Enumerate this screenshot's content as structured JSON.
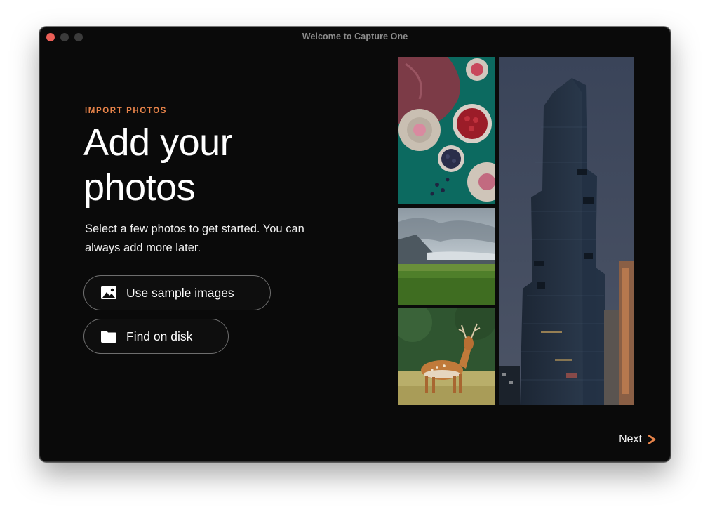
{
  "window": {
    "title": "Welcome to Capture One"
  },
  "main": {
    "eyebrow": "IMPORT PHOTOS",
    "headline": "Add your photos",
    "subtitle": "Select a few photos to get started. You can always add more later.",
    "buttons": [
      {
        "label": "Use sample images",
        "icon": "image-icon"
      },
      {
        "label": "Find on disk",
        "icon": "folder-icon"
      }
    ]
  },
  "gallery": {
    "images": [
      "food-flatlay",
      "landscape-glacier",
      "deer",
      "skyscraper"
    ]
  },
  "footer": {
    "next_label": "Next"
  },
  "colors": {
    "accent": "#e8844a",
    "close": "#ec5f57",
    "background": "#0a0a0a"
  }
}
